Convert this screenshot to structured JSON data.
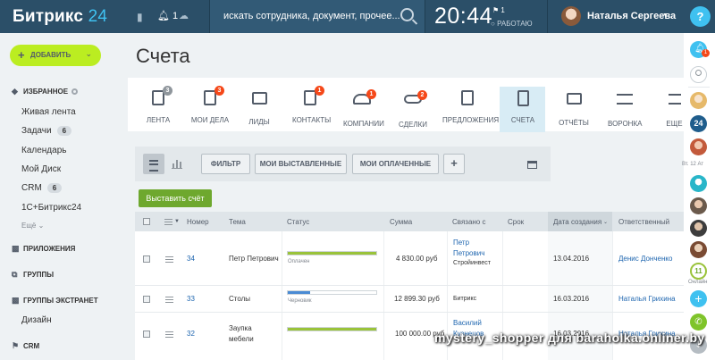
{
  "header": {
    "logo_text": "Битрикс",
    "logo_num": "24",
    "notify_count": "1",
    "search_placeholder": "искать сотрудника, документ, прочее...",
    "clock": "20:44",
    "clock_flag": "1",
    "work_status": "РАБОТАЮ",
    "user_name": "Наталья Сергеева",
    "help_label": "?"
  },
  "sidebar": {
    "add_label": "ДОБАВИТЬ",
    "favorites_label": "ИЗБРАННОЕ",
    "items": [
      {
        "label": "Живая лента"
      },
      {
        "label": "Задачи",
        "badge": "6"
      },
      {
        "label": "Календарь"
      },
      {
        "label": "Мой Диск"
      },
      {
        "label": "CRM",
        "badge": "6"
      },
      {
        "label": "1С+Битрикс24"
      }
    ],
    "more_label": "Ещё",
    "apps_label": "ПРИЛОЖЕНИЯ",
    "groups_label": "ГРУППЫ",
    "extranet_label": "ГРУППЫ ЭКСТРАНЕТ",
    "extranet_item": "Дизайн",
    "crm_label": "CRM"
  },
  "page": {
    "title": "Счета"
  },
  "toolbar": {
    "items": [
      {
        "label": "ЛЕНТА",
        "badge": "3",
        "badge_gray": true
      },
      {
        "label": "МОИ ДЕЛА",
        "badge": "3"
      },
      {
        "label": "ЛИДЫ",
        "badge": ""
      },
      {
        "label": "КОНТАКТЫ",
        "badge": "1"
      },
      {
        "label": "КОМПАНИИ",
        "badge": "1"
      },
      {
        "label": "СДЕЛКИ",
        "badge": "2"
      },
      {
        "label": "ПРЕДЛОЖЕНИЯ",
        "badge": ""
      },
      {
        "label": "СЧЕТА",
        "badge": ""
      },
      {
        "label": "ОТЧЁТЫ",
        "badge": ""
      },
      {
        "label": "ВОРОНКА",
        "badge": ""
      },
      {
        "label": "ЕЩЕ",
        "badge": ""
      }
    ]
  },
  "filters": {
    "filter_label": "ФИЛЬТР",
    "issued_label": "МОИ ВЫСТАВЛЕННЫЕ",
    "paid_label": "МОИ ОПЛАЧЕННЫЕ",
    "plus_label": "+"
  },
  "add_invoice_label": "Выставить счёт",
  "table": {
    "columns": [
      "Номер",
      "Тема",
      "Статус",
      "Сумма",
      "Связано с",
      "Срок",
      "Дата создания",
      "Ответственный"
    ],
    "rows": [
      {
        "number": "34",
        "topic": "Петр Петрович",
        "status": "Оплачен",
        "progress": 1.0,
        "sum": "4 830.00 руб",
        "linked_1": "Петр",
        "linked_2": "Петрович",
        "linked_company": "Стройинвест",
        "due": "",
        "created": "13.04.2016",
        "owner": "Денис Донченко"
      },
      {
        "number": "33",
        "topic": "Столы",
        "status": "Черновик",
        "progress": 0.25,
        "sum": "12 899.30 руб",
        "linked_1": "",
        "linked_2": "",
        "linked_company": "Битрикс",
        "due": "",
        "created": "16.03.2016",
        "owner": "Наталья Грихина"
      },
      {
        "number": "32",
        "topic_1": "Заупка",
        "topic_2": "мебели",
        "status": "",
        "progress": 1.0,
        "sum": "100 000.00 руб",
        "linked_1": "Василий",
        "linked_2": "Кузнецов",
        "linked_company": "",
        "due": "",
        "created": "16.03.2016",
        "owner": "Наталья Грихина"
      }
    ]
  },
  "rail": {
    "date_label": "Вт. 12 Ат",
    "online_count": "11",
    "online_label": "Онлайн",
    "brand_badge": "24",
    "notify_badge": "1"
  },
  "watermark": "mystery_shopper для baraholka.onliner.by",
  "colors": {
    "header_bg": "#2b4f68",
    "accent_green": "#bbed21",
    "invoice_green": "#6ea82e",
    "progress_paid": "#9ac33a",
    "progress_draft": "#4a8bd4",
    "badge_red": "#f54819",
    "link_blue": "#2067b0",
    "help_blue": "#3fc1f0"
  }
}
